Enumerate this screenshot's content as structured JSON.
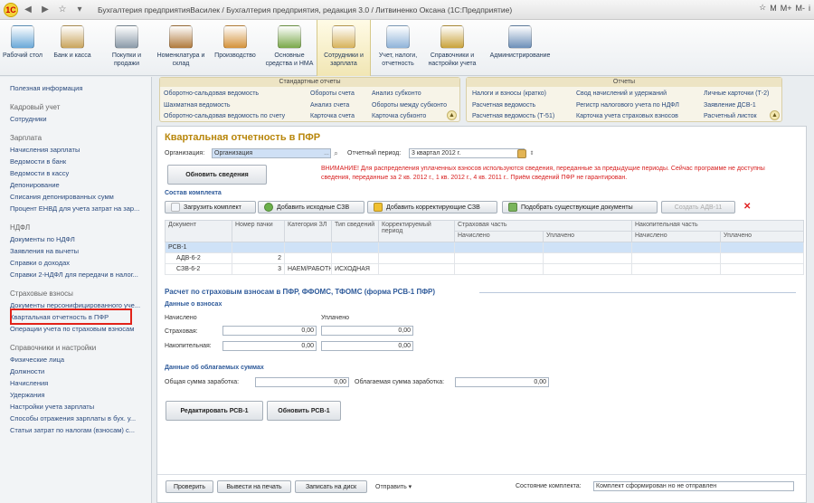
{
  "titlebar": {
    "window_title": "Бухгалтерия предприятияВасилек / Бухгалтерия предприятия, редакция 3.0 / Литвиненко Оксана (1С:Предприятие)",
    "right_buttons": [
      "M",
      "M+",
      "M-",
      "i"
    ]
  },
  "toolbar": [
    {
      "label": "Рабочий стол",
      "icon": "desktop-icon",
      "color": "#6aa8d8"
    },
    {
      "label": "Банк и касса",
      "icon": "bank-icon",
      "color": "#c9a45c"
    },
    {
      "label": "Покупки и продажи",
      "icon": "cart-icon",
      "color": "#8a9aa8"
    },
    {
      "label": "Номенклатура и склад",
      "icon": "warehouse-icon",
      "color": "#b07a3c"
    },
    {
      "label": "Производство",
      "icon": "production-icon",
      "color": "#d4923a"
    },
    {
      "label": "Основные средства и НМА",
      "icon": "assets-icon",
      "color": "#7aa84a"
    },
    {
      "label": "Сотрудники и зарплата",
      "icon": "employees-icon",
      "color": "#d7b25a"
    },
    {
      "label": "Учет, налоги, отчетность",
      "icon": "reports-icon",
      "color": "#8fb3d9"
    },
    {
      "label": "Справочники и настройки учета",
      "icon": "books-icon",
      "color": "#c9a23a"
    },
    {
      "label": "Администрирование",
      "icon": "admin-icon",
      "color": "#6c8fb8"
    }
  ],
  "sidebar": {
    "top": "Полезная информация",
    "groups": [
      {
        "heading": "Кадровый учет",
        "items": [
          "Сотрудники"
        ]
      },
      {
        "heading": "Зарплата",
        "items": [
          "Начисления зарплаты",
          "Ведомости в банк",
          "Ведомости в кассу",
          "Депонирование",
          "Списания депонированных сумм",
          "Процент ЕНВД для учета затрат на зар..."
        ]
      },
      {
        "heading": "НДФЛ",
        "items": [
          "Документы по НДФЛ",
          "Заявления на вычеты",
          "Справки о доходах",
          "Справки 2-НДФЛ для передачи в налог..."
        ]
      },
      {
        "heading": "Страховые взносы",
        "items": [
          "Документы персонифицированного уче...",
          "Квартальная отчетность в ПФР",
          "Операции учета по страховым взносам"
        ]
      },
      {
        "heading": "Справочники и настройки",
        "items": [
          "Физические лица",
          "Должности",
          "Начисления",
          "Удержания",
          "Настройки учета зарплаты",
          "Способы отражения зарплаты в бух. у...",
          "Статьи затрат по налогам (взносам) с..."
        ]
      }
    ]
  },
  "panels": {
    "standard": {
      "title": "Стандартные отчеты",
      "items": [
        "Оборотно-сальдовая ведомость",
        "Шахматная ведомость",
        "Оборотно-сальдовая ведомость по счету",
        "Обороты счета",
        "Анализ счета",
        "Карточка счета",
        "Анализ субконто",
        "Обороты между субконто",
        "Карточка субконто"
      ]
    },
    "reports": {
      "title": "Отчеты",
      "items": [
        "Налоги и взносы (кратко)",
        "Расчетная ведомость",
        "Расчетная ведомость (Т-51)",
        "Свод начислений и удержаний",
        "Регистр налогового учета по НДФЛ",
        "Карточка учета страховых взносов",
        "Личные карточки (Т-2)",
        "Заявление ДСВ-1",
        "Расчетный листок"
      ]
    }
  },
  "form": {
    "title": "Квартальная отчетность в ПФР",
    "org_label": "Организация:",
    "org_value": "Организация",
    "period_label": "Отчетный период:",
    "period_value": "3 квартал 2012 г.",
    "update_btn": "Обновить сведения",
    "warning": "ВНИМАНИЕ! Для распределения уплаченных взносов используются сведения, переданные за предыдущие периоды. Сейчас программе не доступны сведения, переданные за 2 кв. 2012 г., 1 кв. 2012 г., 4 кв. 2011 г.. Приём сведений ПФР не гарантирован.",
    "composition_title": "Состав комплекта",
    "buttons": [
      "Загрузить комплект",
      "Добавить исходные СЗВ",
      "Добавить корректирующие СЗВ",
      "Подобрать существующие документы",
      "Создать АДВ-11"
    ],
    "table": {
      "headers": [
        "Документ",
        "Номер пачки",
        "Категория ЗЛ",
        "Тип сведений",
        "Корректируемый период",
        "Страховая часть",
        "Накопительная часть"
      ],
      "subheaders": [
        "Начислено",
        "Уплачено",
        "Начислено",
        "Уплачено"
      ],
      "rows": [
        {
          "doc": "РСВ-1",
          "num": "",
          "cat": "",
          "type": ""
        },
        {
          "doc": "АДВ-6-2",
          "num": "2",
          "cat": "",
          "type": ""
        },
        {
          "doc": "СЗВ-6-2",
          "num": "3",
          "cat": "НАЕМ/РАБОТН",
          "type": "ИСХОДНАЯ"
        }
      ]
    },
    "rsv_title": "Расчет по страховым взносам в ПФР, ФФОМС, ТФОМС (форма РСВ-1 ПФР)",
    "contrib_title": "Данные о взносах",
    "accrued": "Начислено",
    "paid": "Уплачено",
    "insurance_label": "Страховая:",
    "savings_label": "Накопительная:",
    "values": {
      "ins_acc": "0,00",
      "ins_paid": "0,00",
      "sav_acc": "0,00",
      "sav_paid": "0,00"
    },
    "taxable_title": "Данные об облагаемых суммах",
    "total_salary_label": "Общая сумма заработка:",
    "total_salary": "0,00",
    "taxable_salary_label": "Облагаемая сумма заработка:",
    "taxable_salary": "0,00",
    "edit_btn": "Редактировать РСВ-1",
    "refresh_btn": "Обновить РСВ-1",
    "bottom": {
      "check": "Проверить",
      "export": "Вывести на печать",
      "save": "Записать на диск",
      "send": "Отправить",
      "state_label": "Состояние комплекта:",
      "state_value": "Комплект сформирован но не отправлен"
    }
  }
}
